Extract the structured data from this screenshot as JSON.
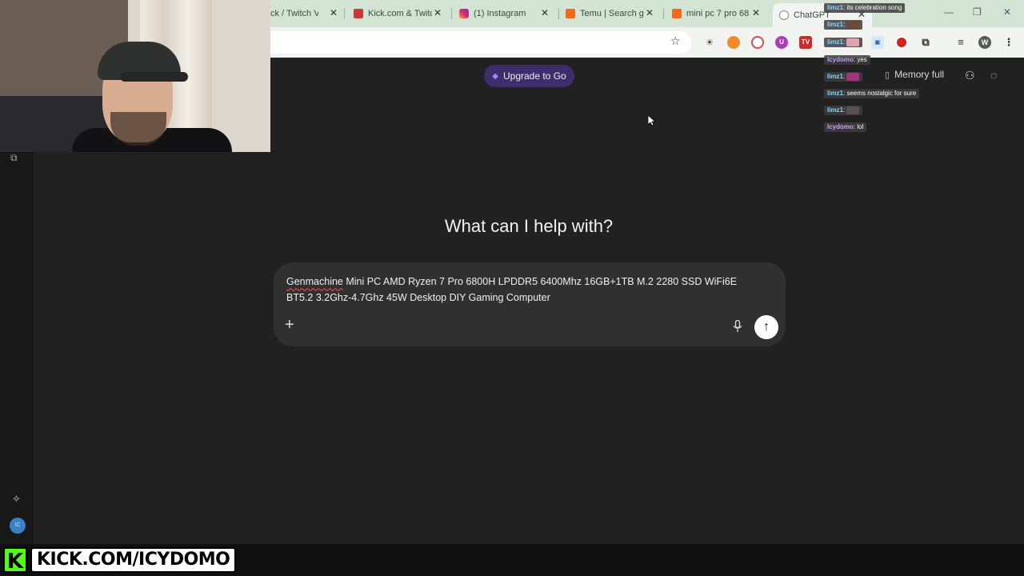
{
  "browser": {
    "tabs": [
      {
        "title": "ck / Twitch VOD",
        "close": "✕"
      },
      {
        "title": "Kick.com & Twitch",
        "close": "✕"
      },
      {
        "title": "(1) Instagram",
        "close": "✕"
      },
      {
        "title": "Temu | Search g",
        "close": "✕"
      },
      {
        "title": "mini pc 7 pro 68",
        "close": "✕"
      },
      {
        "title": "ChatGPT",
        "close": "✕"
      }
    ],
    "window_controls": [
      "—",
      "❐",
      "✕"
    ],
    "profile_initial": "W"
  },
  "chatgpt": {
    "upgrade_label": "Upgrade to Go",
    "memory_label": "Memory full",
    "heading": "What can I help with?",
    "prompt_line1_misspelled": "Genmachine",
    "prompt_line1_rest": " Mini PC AMD Ryzen 7 Pro 6800H LPDDR5 6400Mhz 16GB+1TB M.2 2280 SSD WiFi6E",
    "prompt_line2": "BT5.2 3.2Ghz-4.7Ghz 45W Desktop DIY Gaming Computer",
    "plus_glyph": "+",
    "send_glyph": "↑",
    "avatar_initials": "IC"
  },
  "stream_chat": [
    {
      "user": "limz1",
      "text": ": its celebration song"
    },
    {
      "user": "limz1",
      "text": ":"
    },
    {
      "user": "limz1",
      "text": ":"
    },
    {
      "user": "Icydomo",
      "text": ": yes"
    },
    {
      "user": "limz1",
      "text": ":"
    },
    {
      "user": "limz1",
      "text": ": seems nostalgic for sure"
    },
    {
      "user": "limz1",
      "text": ":"
    },
    {
      "user": "Icydomo",
      "text": ": lol"
    }
  ],
  "overlay": {
    "kick_letter": "K",
    "kick_url": "KICK.COM/ICYDOMO"
  }
}
